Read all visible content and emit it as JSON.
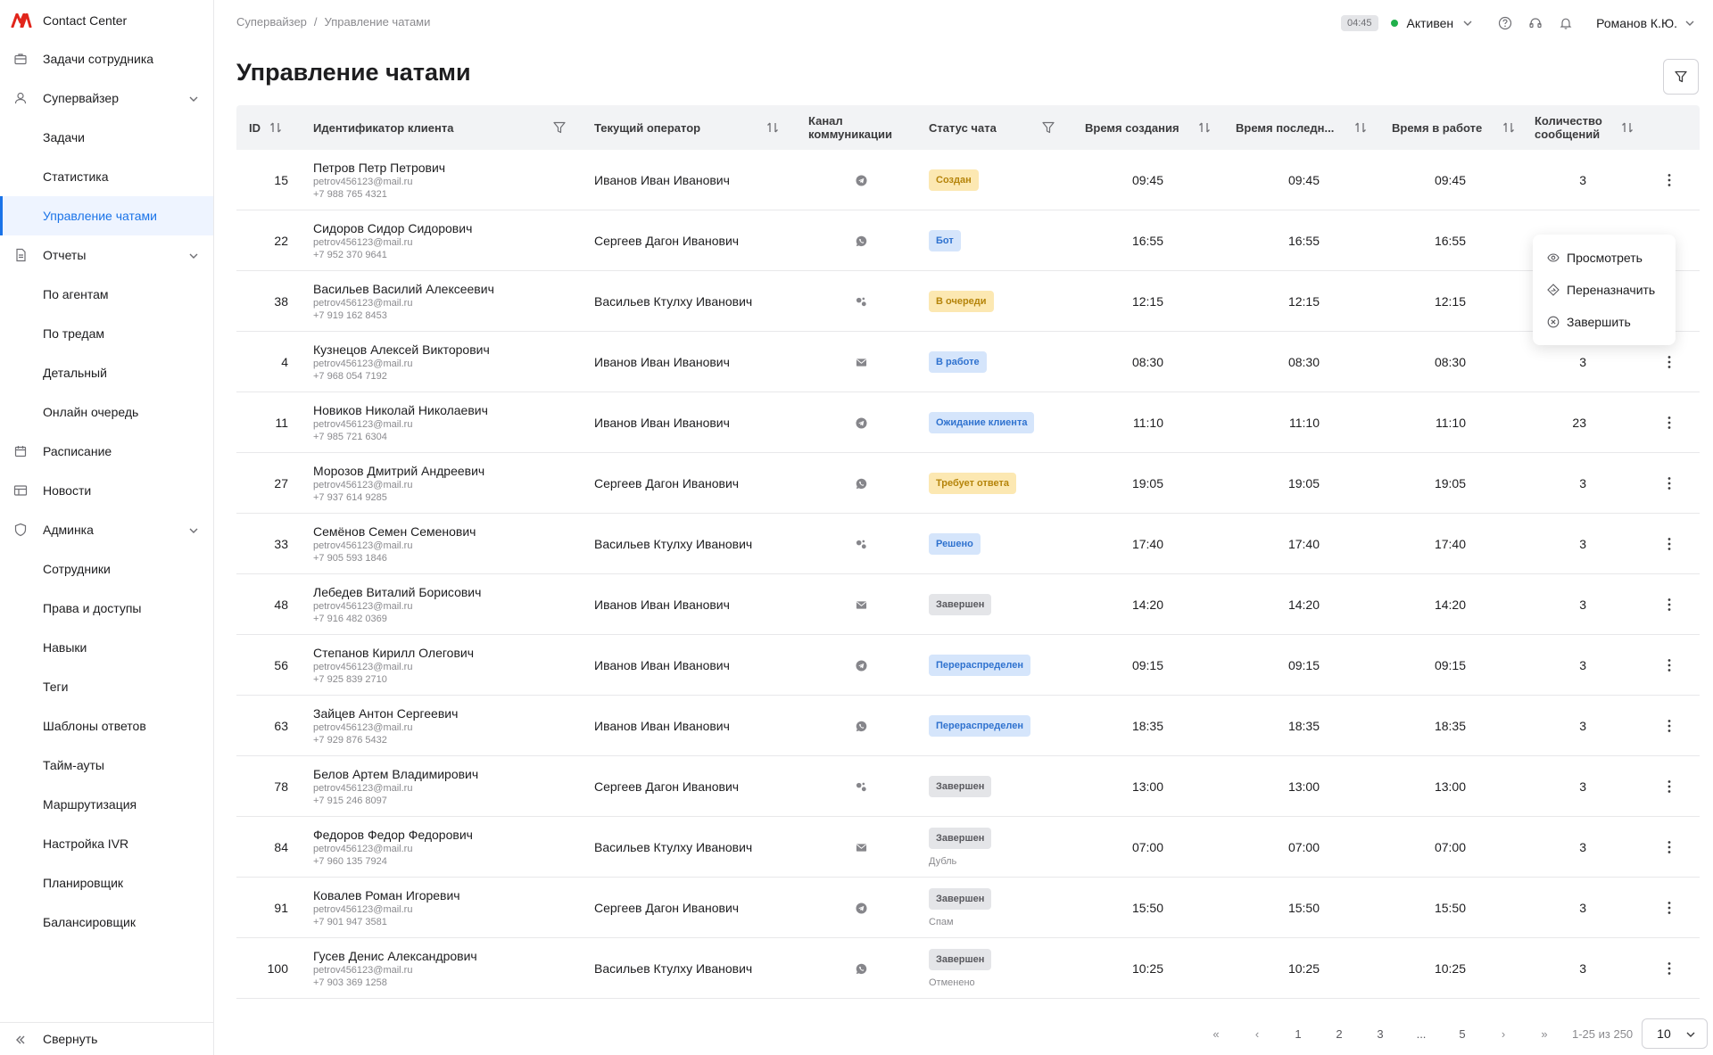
{
  "brand": {
    "name": "Contact Center",
    "color": "#e1251b"
  },
  "sidebar": {
    "items": [
      {
        "label": "Задачи сотрудника",
        "icon": "briefcase-icon",
        "level": 0
      },
      {
        "label": "Супервайзер",
        "icon": "user-icon",
        "level": 0,
        "expandable": true
      },
      {
        "label": "Задачи",
        "level": 1
      },
      {
        "label": "Статистика",
        "level": 1
      },
      {
        "label": "Управление чатами",
        "level": 1,
        "active": true
      },
      {
        "label": "Отчеты",
        "icon": "document-icon",
        "level": 0,
        "expandable": true
      },
      {
        "label": "По агентам",
        "level": 1
      },
      {
        "label": "По тредам",
        "level": 1
      },
      {
        "label": "Детальный",
        "level": 1
      },
      {
        "label": "Онлайн очередь",
        "level": 1
      },
      {
        "label": "Расписание",
        "icon": "calendar-icon",
        "level": 0
      },
      {
        "label": "Новости",
        "icon": "news-icon",
        "level": 0
      },
      {
        "label": "Админка",
        "icon": "shield-icon",
        "level": 0,
        "expandable": true
      },
      {
        "label": "Сотрудники",
        "level": 1
      },
      {
        "label": "Права и доступы",
        "level": 1
      },
      {
        "label": "Навыки",
        "level": 1
      },
      {
        "label": "Теги",
        "level": 1
      },
      {
        "label": "Шаблоны ответов",
        "level": 1
      },
      {
        "label": "Тайм-ауты",
        "level": 1
      },
      {
        "label": "Маршрутизация",
        "level": 1
      },
      {
        "label": "Настройка IVR",
        "level": 1
      },
      {
        "label": "Планировщик",
        "level": 1
      },
      {
        "label": "Балансировщик",
        "level": 1
      }
    ],
    "collapse_label": "Свернуть"
  },
  "breadcrumb": {
    "root": "Супервайзер",
    "separator": "/",
    "current": "Управление чатами"
  },
  "topbar": {
    "timer": "04:45",
    "status": "Активен",
    "status_color": "#20b04b",
    "user": "Романов К.Ю."
  },
  "page_title": "Управление чатами",
  "table": {
    "headers": {
      "id": "ID",
      "client": "Идентификатор клиента",
      "operator": "Текущий оператор",
      "channel_1": "Канал",
      "channel_2": "коммуникации",
      "status": "Статус чата",
      "created": "Время создания",
      "last": "Время последн...",
      "work": "Время в работе",
      "count_1": "Количество",
      "count_2": "сообщений"
    },
    "rows": [
      {
        "id": "15",
        "name": "Петров Петр Петрович",
        "email": "petrov456123@mail.ru",
        "phone": "+7 988 765 4321",
        "operator": "Иванов Иван Иванович",
        "channel": "telegram",
        "status": "Создан",
        "status_color": "yellow",
        "sub": "",
        "created": "09:45",
        "last": "09:45",
        "work": "09:45",
        "count": "3"
      },
      {
        "id": "22",
        "name": "Сидоров Сидор Сидорович",
        "email": "petrov456123@mail.ru",
        "phone": "+7 952 370 9641",
        "operator": "Сергеев Дагон Иванович",
        "channel": "whatsapp",
        "status": "Бот",
        "status_color": "blue",
        "sub": "",
        "created": "16:55",
        "last": "16:55",
        "work": "16:55",
        "count": ""
      },
      {
        "id": "38",
        "name": "Васильев Василий Алексеевич",
        "email": "petrov456123@mail.ru",
        "phone": "+7 919 162 8453",
        "operator": "Васильев Ктулху Иванович",
        "channel": "chat",
        "status": "В очереди",
        "status_color": "yellow",
        "sub": "",
        "created": "12:15",
        "last": "12:15",
        "work": "12:15",
        "count": ""
      },
      {
        "id": "4",
        "name": "Кузнецов Алексей Викторович",
        "email": "petrov456123@mail.ru",
        "phone": "+7 968 054 7192",
        "operator": "Иванов Иван Иванович",
        "channel": "email",
        "status": "В работе",
        "status_color": "blue",
        "sub": "",
        "created": "08:30",
        "last": "08:30",
        "work": "08:30",
        "count": "3"
      },
      {
        "id": "11",
        "name": "Новиков Николай Николаевич",
        "email": "petrov456123@mail.ru",
        "phone": "+7 985 721 6304",
        "operator": "Иванов Иван Иванович",
        "channel": "telegram",
        "status": "Ожидание клиента",
        "status_color": "blue",
        "sub": "",
        "created": "11:10",
        "last": "11:10",
        "work": "11:10",
        "count": "23"
      },
      {
        "id": "27",
        "name": "Морозов Дмитрий Андреевич",
        "email": "petrov456123@mail.ru",
        "phone": "+7 937 614 9285",
        "operator": "Сергеев Дагон Иванович",
        "channel": "whatsapp",
        "status": "Требует ответа",
        "status_color": "yellow",
        "sub": "",
        "created": "19:05",
        "last": "19:05",
        "work": "19:05",
        "count": "3"
      },
      {
        "id": "33",
        "name": "Семёнов Семен Семенович",
        "email": "petrov456123@mail.ru",
        "phone": "+7 905 593 1846",
        "operator": "Васильев Ктулху Иванович",
        "channel": "chat",
        "status": "Решено",
        "status_color": "blue",
        "sub": "",
        "created": "17:40",
        "last": "17:40",
        "work": "17:40",
        "count": "3"
      },
      {
        "id": "48",
        "name": "Лебедев Виталий Борисович",
        "email": "petrov456123@mail.ru",
        "phone": "+7 916 482 0369",
        "operator": "Иванов Иван Иванович",
        "channel": "email",
        "status": "Завершен",
        "status_color": "gray",
        "sub": "",
        "created": "14:20",
        "last": "14:20",
        "work": "14:20",
        "count": "3"
      },
      {
        "id": "56",
        "name": "Степанов Кирилл Олегович",
        "email": "petrov456123@mail.ru",
        "phone": "+7 925 839 2710",
        "operator": "Иванов Иван Иванович",
        "channel": "telegram",
        "status": "Перераспределен",
        "status_color": "blue",
        "sub": "",
        "created": "09:15",
        "last": "09:15",
        "work": "09:15",
        "count": "3"
      },
      {
        "id": "63",
        "name": "Зайцев Антон Сергеевич",
        "email": "petrov456123@mail.ru",
        "phone": "+7 929 876 5432",
        "operator": "Иванов Иван Иванович",
        "channel": "whatsapp",
        "status": "Перераспределен",
        "status_color": "blue",
        "sub": "",
        "created": "18:35",
        "last": "18:35",
        "work": "18:35",
        "count": "3"
      },
      {
        "id": "78",
        "name": "Белов Артем Владимирович",
        "email": "petrov456123@mail.ru",
        "phone": "+7 915 246 8097",
        "operator": "Сергеев Дагон Иванович",
        "channel": "chat",
        "status": "Завершен",
        "status_color": "gray",
        "sub": "",
        "created": "13:00",
        "last": "13:00",
        "work": "13:00",
        "count": "3"
      },
      {
        "id": "84",
        "name": "Федоров Федор Федорович",
        "email": "petrov456123@mail.ru",
        "phone": "+7 960 135 7924",
        "operator": "Васильев Ктулху Иванович",
        "channel": "email",
        "status": "Завершен",
        "status_color": "gray",
        "sub": "Дубль",
        "created": "07:00",
        "last": "07:00",
        "work": "07:00",
        "count": "3"
      },
      {
        "id": "91",
        "name": "Ковалев Роман Игоревич",
        "email": "petrov456123@mail.ru",
        "phone": "+7 901 947 3581",
        "operator": "Сергеев Дагон Иванович",
        "channel": "telegram",
        "status": "Завершен",
        "status_color": "gray",
        "sub": "Спам",
        "created": "15:50",
        "last": "15:50",
        "work": "15:50",
        "count": "3"
      },
      {
        "id": "100",
        "name": "Гусев Денис Александрович",
        "email": "petrov456123@mail.ru",
        "phone": "+7 903 369 1258",
        "operator": "Васильев Ктулху Иванович",
        "channel": "whatsapp",
        "status": "Завершен",
        "status_color": "gray",
        "sub": "Отменено",
        "created": "10:25",
        "last": "10:25",
        "work": "10:25",
        "count": "3"
      }
    ]
  },
  "context_menu": {
    "items": [
      {
        "label": "Просмотреть",
        "icon": "eye-icon"
      },
      {
        "label": "Переназначить",
        "icon": "reassign-icon"
      },
      {
        "label": "Завершить",
        "icon": "close-circle-icon"
      }
    ]
  },
  "pagination": {
    "first": "«",
    "prev": "‹",
    "next": "›",
    "last": "»",
    "pages": [
      "1",
      "2",
      "3",
      "...",
      "5"
    ],
    "range": "1-25 из 250",
    "page_size": "10"
  }
}
